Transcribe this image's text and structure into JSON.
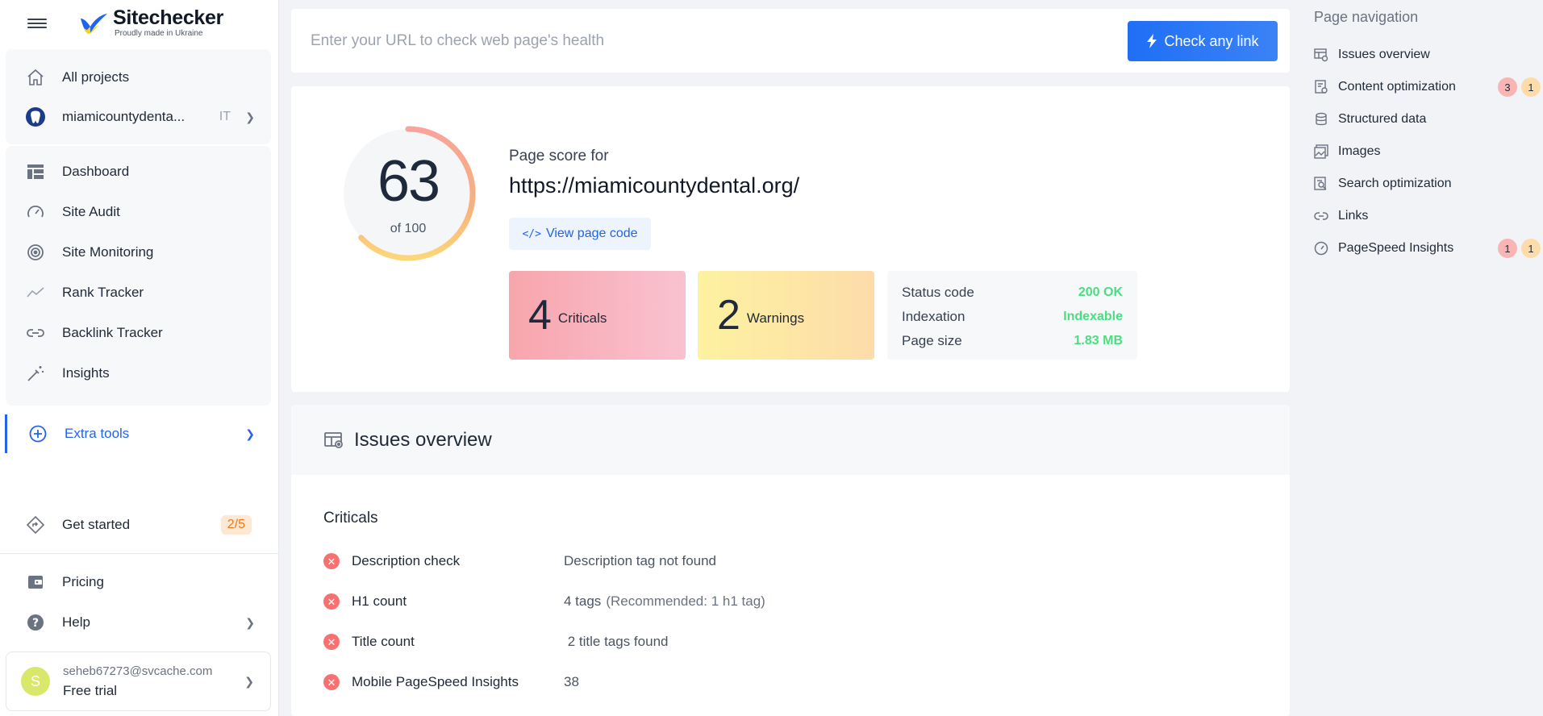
{
  "brand": {
    "name": "Sitechecker",
    "tagline": "Proudly made in Ukraine"
  },
  "sidebar": {
    "all_projects": "All projects",
    "project_name": "miamicountydenta...",
    "project_lang": "IT",
    "items": [
      {
        "label": "Dashboard",
        "icon": "dashboard-icon"
      },
      {
        "label": "Site Audit",
        "icon": "gauge-icon"
      },
      {
        "label": "Site Monitoring",
        "icon": "radar-icon"
      },
      {
        "label": "Rank Tracker",
        "icon": "trend-icon"
      },
      {
        "label": "Backlink Tracker",
        "icon": "link-icon"
      },
      {
        "label": "Insights",
        "icon": "magic-wand-icon"
      }
    ],
    "extra_tools": "Extra tools",
    "get_started": {
      "label": "Get started",
      "progress": "2/5"
    },
    "pricing": "Pricing",
    "help": "Help",
    "user": {
      "initial": "S",
      "email": "seheb67273@svcache.com",
      "plan": "Free trial"
    }
  },
  "search": {
    "placeholder": "Enter your URL to check web page's health",
    "button": "Check any link"
  },
  "score": {
    "value": "63",
    "of": "of 100",
    "fraction": 0.63,
    "label": "Page score for",
    "url": "https://miamicountydental.org/",
    "view_code": "View page code",
    "criticals": {
      "count": "4",
      "label": "Criticals"
    },
    "warnings": {
      "count": "2",
      "label": "Warnings"
    },
    "status": [
      {
        "key": "Status code",
        "value": "200 OK"
      },
      {
        "key": "Indexation",
        "value": "Indexable"
      },
      {
        "key": "Page size",
        "value": "1.83 MB"
      }
    ]
  },
  "issues": {
    "title": "Issues overview",
    "criticals_title": "Criticals",
    "rows": [
      {
        "name": "Description check",
        "value": "Description tag not found",
        "note": ""
      },
      {
        "name": "H1 count",
        "value": "4 tags",
        "note": "(Recommended: 1 h1 tag)"
      },
      {
        "name": "Title count",
        "value": " 2 title tags found",
        "note": ""
      },
      {
        "name": "Mobile PageSpeed Insights",
        "value": "38",
        "note": ""
      }
    ]
  },
  "page_nav": {
    "title": "Page navigation",
    "items": [
      {
        "label": "Issues overview",
        "critical": "",
        "warning": ""
      },
      {
        "label": "Content optimization",
        "critical": "3",
        "warning": "1"
      },
      {
        "label": "Structured data",
        "critical": "",
        "warning": ""
      },
      {
        "label": "Images",
        "critical": "",
        "warning": ""
      },
      {
        "label": "Search optimization",
        "critical": "",
        "warning": ""
      },
      {
        "label": "Links",
        "critical": "",
        "warning": ""
      },
      {
        "label": "PageSpeed Insights",
        "critical": "1",
        "warning": "1"
      }
    ]
  },
  "colors": {
    "accent": "#2563eb",
    "critical": "#f87171",
    "good": "#4ade80",
    "warning": "#fbbf24"
  }
}
